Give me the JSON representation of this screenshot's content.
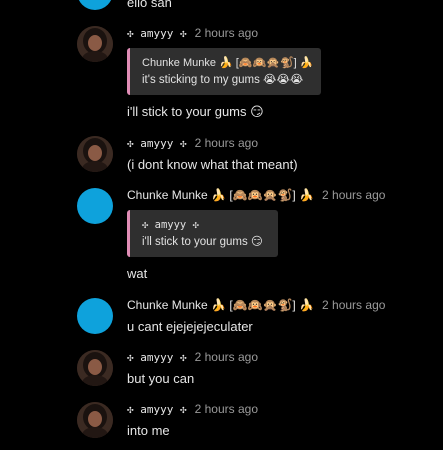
{
  "messages": [
    {
      "author": "",
      "time": "",
      "text": "ello san"
    },
    {
      "author": "✣ amyyy ✣",
      "time": "2 hours ago",
      "reply": {
        "author": "Chunke Munke 🍌 [🙈🙉🙊🐒] 🍌",
        "text": "it's sticking to my gums 😭😭😭"
      },
      "text": "i'll stick to your gums 😏"
    },
    {
      "author": "✣ amyyy ✣",
      "time": "2 hours ago",
      "text": "(i dont know what that meant)"
    },
    {
      "author": "Chunke Munke 🍌 [🙈🙉🙊🐒] 🍌",
      "time": "2 hours ago",
      "reply": {
        "author": "✣ amyyy ✣",
        "text": "i'll stick to your gums 😏"
      },
      "text": "wat"
    },
    {
      "author": "Chunke Munke 🍌 [🙈🙉🙊🐒] 🍌",
      "time": "2 hours ago",
      "text": "u cant ejejejejeculater"
    },
    {
      "author": "✣ amyyy ✣",
      "time": "2 hours ago",
      "text": "but you can"
    },
    {
      "author": "✣ amyyy ✣",
      "time": "2 hours ago",
      "text": "into me"
    }
  ],
  "colors": {
    "background": "#000000",
    "reply_accent": "#e08db6",
    "timestamp": "#9a9a9a",
    "blue_avatar": "#0ea2dc"
  }
}
